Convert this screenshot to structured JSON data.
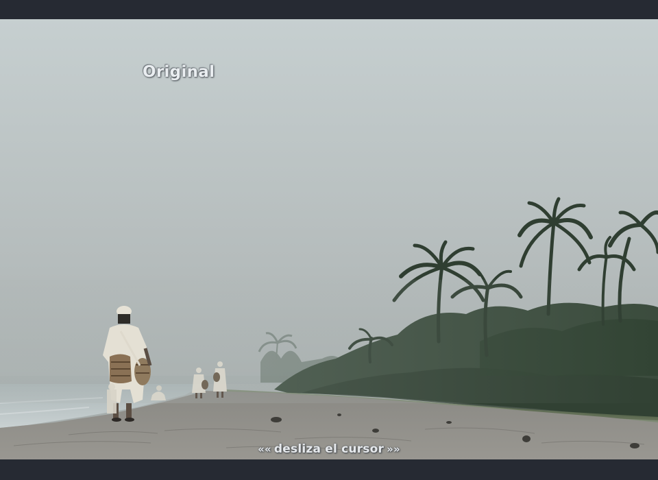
{
  "image": {
    "label": "Original",
    "hint": {
      "left_arrows": "««",
      "text": "desliza el cursor",
      "right_arrows": "»»"
    },
    "colors": {
      "frame": "#262a33",
      "sky_top": "#c7cfd0",
      "sky_bottom": "#a4abab",
      "sand": "#8f8d88",
      "sea": "#b9c3c5",
      "vegetation": "#354735"
    },
    "scene": "misty beach with palm trees and walking figures in white robes"
  }
}
